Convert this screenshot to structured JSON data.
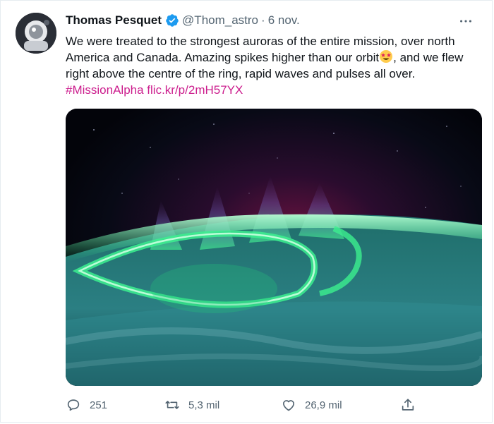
{
  "tweet": {
    "author_name": "Thomas Pesquet",
    "handle": "@Thom_astro",
    "separator": "·",
    "date": "6 nov.",
    "text_part1": "We were treated to the strongest auroras of the entire mission, over north America and Canada. Amazing spikes higher than our orbit",
    "text_part2": ", and we flew right above the centre of the ring, rapid waves and pulses all over.",
    "hashtag": "#MissionAlpha",
    "short_link": "flic.kr/p/2mH57YX",
    "emoji": "star-struck-emoji",
    "more_icon": "more-options-icon"
  },
  "actions": {
    "replies": "251",
    "retweets": "5,3 mil",
    "likes": "26,9 mil"
  },
  "colors": {
    "link": "#cc1d8d",
    "verified": "#1d9bf0",
    "secondary_text": "#536471"
  }
}
